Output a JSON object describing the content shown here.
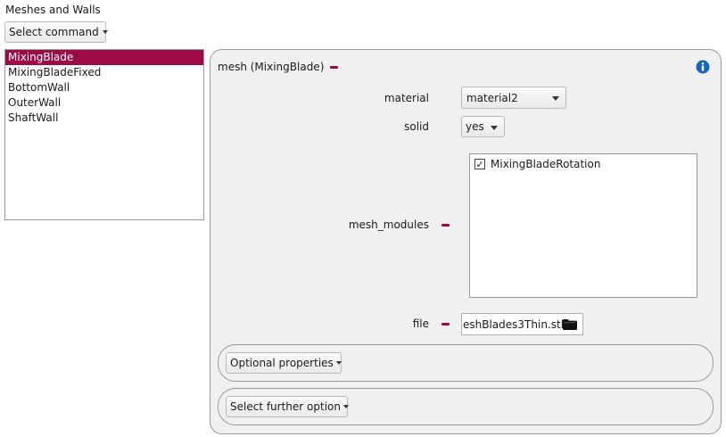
{
  "section_title": "Meshes and Walls",
  "command_select": {
    "label": "Select command"
  },
  "meshes": [
    {
      "label": "MixingBlade",
      "selected": true
    },
    {
      "label": "MixingBladeFixed",
      "selected": false
    },
    {
      "label": "BottomWall",
      "selected": false
    },
    {
      "label": "OuterWall",
      "selected": false
    },
    {
      "label": "ShaftWall",
      "selected": false
    }
  ],
  "detail": {
    "header": "mesh (MixingBlade)",
    "material": {
      "label": "material",
      "value": "material2"
    },
    "solid": {
      "label": "solid",
      "value": "yes"
    },
    "mesh_modules": {
      "label": "mesh_modules",
      "items": [
        {
          "label": "MixingBladeRotation",
          "checked": true
        }
      ]
    },
    "file": {
      "label": "file",
      "value": "eshBlades3Thin.stl"
    },
    "optional_properties": {
      "label": "Optional properties"
    },
    "further_option": {
      "label": "Select further option"
    }
  },
  "colors": {
    "accent": "#9c0b45",
    "info": "#1565c0"
  }
}
